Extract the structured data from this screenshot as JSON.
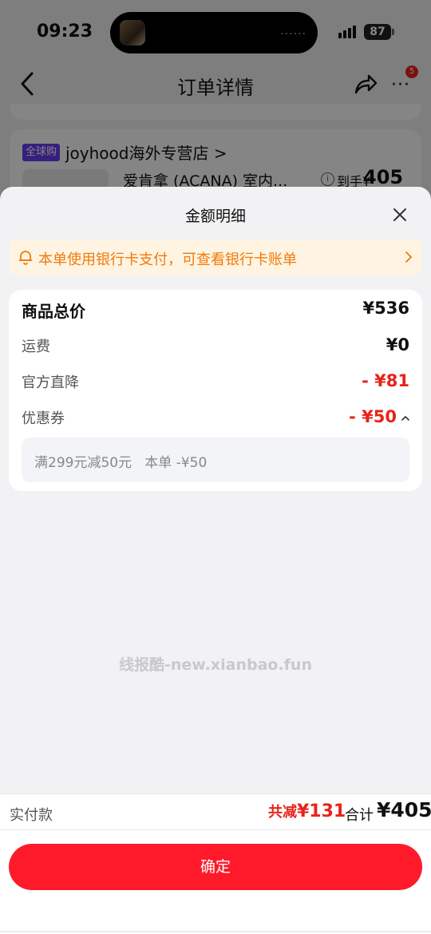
{
  "status_bar": {
    "time": "09:23",
    "island_dots": "......",
    "battery": "87"
  },
  "nav": {
    "title": "订单详情",
    "badge_count": "5"
  },
  "store": {
    "badge": "全球购",
    "name": "joyhood海外专营店 >",
    "product_name": "爱肯拿 (ACANA) 室内...",
    "price_label": "到手¥",
    "price": "405"
  },
  "sheet": {
    "title": "金额明细",
    "notice": "本单使用银行卡支付，可查看银行卡账单",
    "rows": [
      {
        "label": "商品总价",
        "value": "¥536"
      },
      {
        "label": "运费",
        "value": "¥0"
      },
      {
        "label": "官方直降",
        "value": "- ¥81"
      },
      {
        "label": "优惠券",
        "value": "- ¥50"
      }
    ],
    "coupon_detail": "满299元减50元   本单 -¥50",
    "watermark": "线报酷-new.xianbao.fun"
  },
  "footer": {
    "pay_label": "实付款",
    "discount_prefix": "共减",
    "discount_value": "¥131",
    "total_label": "合计",
    "total_value": "¥405",
    "confirm_label": "确定"
  },
  "colors": {
    "accent_red": "#fe1a2a",
    "price_red": "#e8231c",
    "notice_orange": "#f07a0c",
    "global_badge": "#6a3df0"
  }
}
